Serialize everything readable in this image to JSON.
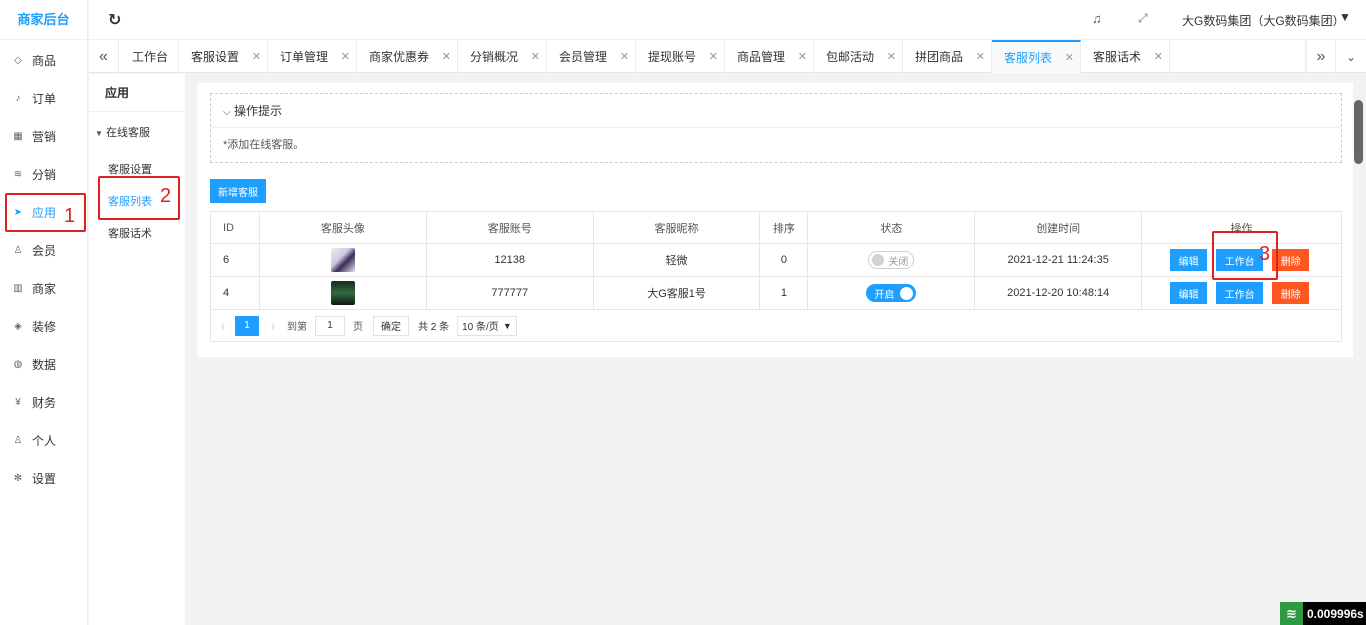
{
  "sidebar": {
    "logo": "商家后台",
    "items": [
      {
        "label": "商品",
        "icon": "diamond-icon"
      },
      {
        "label": "订单",
        "icon": "bell-icon"
      },
      {
        "label": "营销",
        "icon": "grid-icon"
      },
      {
        "label": "分销",
        "icon": "layers-icon"
      },
      {
        "label": "应用",
        "icon": "send-icon"
      },
      {
        "label": "会员",
        "icon": "user-icon"
      },
      {
        "label": "商家",
        "icon": "columns-icon"
      },
      {
        "label": "装修",
        "icon": "tag-icon"
      },
      {
        "label": "数据",
        "icon": "globe-icon"
      },
      {
        "label": "财务",
        "icon": "yen-icon"
      },
      {
        "label": "个人",
        "icon": "person-icon"
      },
      {
        "label": "设置",
        "icon": "gear-icon"
      }
    ]
  },
  "annotations": {
    "a1": "1",
    "a2": "2",
    "a3": "3"
  },
  "subnav": {
    "title": "应用",
    "group": "在线客服",
    "items": [
      "客服设置",
      "客服列表",
      "客服话术"
    ]
  },
  "topbar": {
    "refresh_icon": "refresh-icon",
    "user": "大G数码集团（大G数码集团）"
  },
  "tabs": [
    "工作台",
    "客服设置",
    "订单管理",
    "商家优惠券",
    "分销概况",
    "会员管理",
    "提现账号",
    "商品管理",
    "包邮活动",
    "拼团商品",
    "客服列表",
    "客服话术"
  ],
  "tips": {
    "title": "操作提示",
    "body": "*添加在线客服。"
  },
  "add_button": "新增客服",
  "table": {
    "headers": [
      "ID",
      "客服头像",
      "客服账号",
      "客服昵称",
      "排序",
      "状态",
      "创建时间",
      "操作"
    ],
    "rows": [
      {
        "id": "6",
        "account": "12138",
        "nickname": "轻微",
        "sort": "0",
        "status": "关闭",
        "created": "2021-12-21 11:24:35"
      },
      {
        "id": "4",
        "account": "777777",
        "nickname": "大G客服1号",
        "sort": "1",
        "status": "开启",
        "created": "2021-12-20 10:48:14"
      }
    ],
    "actions": {
      "edit": "编辑",
      "workbench": "工作台",
      "delete": "删除"
    }
  },
  "pagination": {
    "current": "1",
    "goto_label": "到第",
    "goto_value": "1",
    "page_unit": "页",
    "confirm": "确定",
    "total": "共 2 条",
    "page_size": "10 条/页"
  },
  "timer": "0.009996s",
  "colors": {
    "accent": "#1e9fff",
    "danger": "#ff5722",
    "annotation": "#e02020"
  }
}
